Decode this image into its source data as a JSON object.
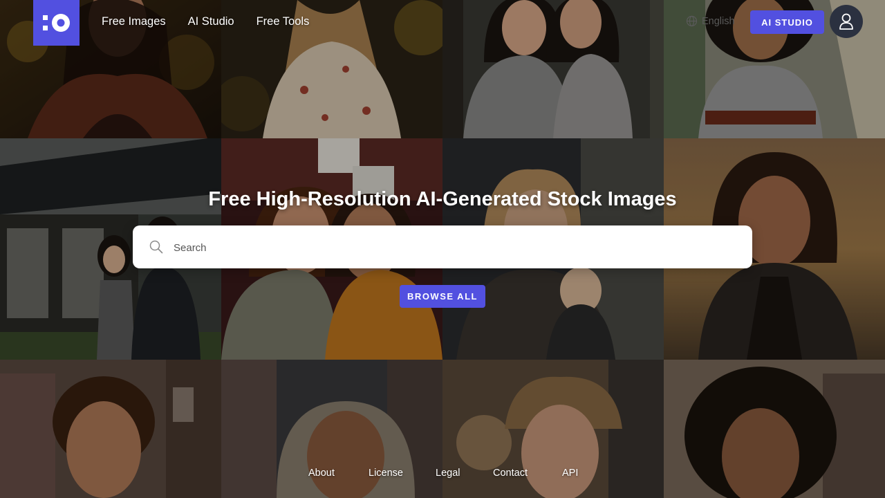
{
  "header": {
    "nav": [
      "Free Images",
      "AI Studio",
      "Free Tools"
    ],
    "language": "English",
    "cta_label": "AI STUDIO"
  },
  "hero": {
    "title": "Free High-Resolution AI-Generated Stock Images",
    "search_placeholder": "Search",
    "browse_label": "BROWSE ALL"
  },
  "footer": {
    "links": [
      "About",
      "License",
      "Legal",
      "Contact",
      "API"
    ]
  },
  "colors": {
    "accent": "#5250e0",
    "user_button": "#2b3140"
  },
  "icons": [
    "logo-mark",
    "globe-icon",
    "user-icon",
    "search-icon"
  ]
}
